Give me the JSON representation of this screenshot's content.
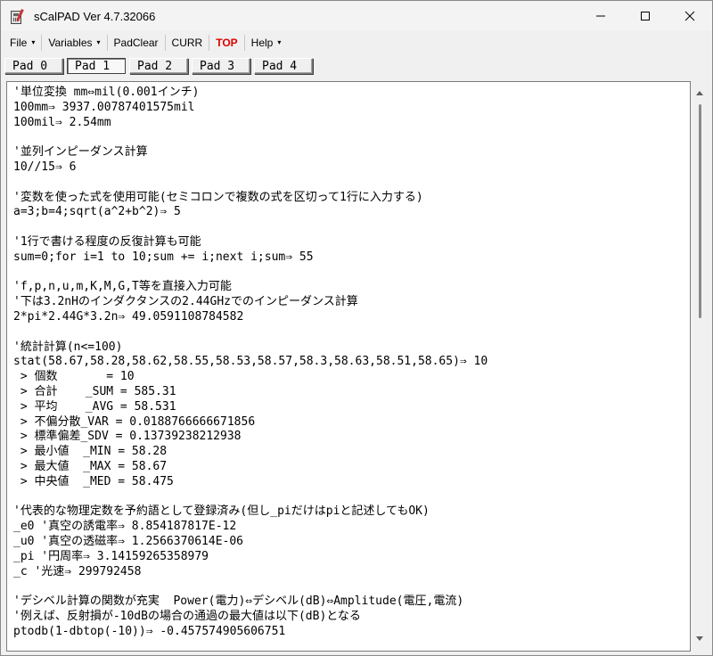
{
  "window": {
    "title": "sCalPAD Ver 4.7.32066"
  },
  "menu": {
    "items": [
      {
        "label": "File",
        "arrow": "▾"
      },
      {
        "label": "Variables",
        "arrow": "▾"
      },
      {
        "label": "PadClear"
      },
      {
        "label": "CURR"
      },
      {
        "label": "TOP"
      },
      {
        "label": "Help",
        "arrow": "▾"
      }
    ]
  },
  "tabs": [
    {
      "label": "Pad 0"
    },
    {
      "label": "Pad 1",
      "active": true
    },
    {
      "label": "Pad 2"
    },
    {
      "label": "Pad 3"
    },
    {
      "label": "Pad 4"
    }
  ],
  "editor": {
    "lines": [
      "'単位変換 mm⇔mil(0.001インチ)",
      "100mm⇒ 3937.00787401575mil",
      "100mil⇒ 2.54mm",
      "",
      "'並列インピーダンス計算",
      "10//15⇒ 6",
      "",
      "'変数を使った式を使用可能(セミコロンで複数の式を区切って1行に入力する)",
      "a=3;b=4;sqrt(a^2+b^2)⇒ 5",
      "",
      "'1行で書ける程度の反復計算も可能",
      "sum=0;for i=1 to 10;sum += i;next i;sum⇒ 55",
      "",
      "'f,p,n,u,m,K,M,G,T等を直接入力可能",
      "'下は3.2nHのインダクタンスの2.44GHzでのインピーダンス計算",
      "2*pi*2.44G*3.2n⇒ 49.0591108784582",
      "",
      "'統計計算(n<=100)",
      "stat(58.67,58.28,58.62,58.55,58.53,58.57,58.3,58.63,58.51,58.65)⇒ 10",
      " > 個数       = 10",
      " > 合計    _SUM = 585.31",
      " > 平均    _AVG = 58.531",
      " > 不偏分散_VAR = 0.0188766666671856",
      " > 標準偏差_SDV = 0.13739238212938",
      " > 最小値  _MIN = 58.28",
      " > 最大値  _MAX = 58.67",
      " > 中央値  _MED = 58.475",
      "",
      "'代表的な物理定数を予約語として登録済み(但し_piだけはpiと記述してもOK)",
      "_e0 '真空の誘電率⇒ 8.854187817E-12",
      "_u0 '真空の透磁率⇒ 1.2566370614E-06",
      "_pi '円周率⇒ 3.14159265358979",
      "_c '光速⇒ 299792458",
      "",
      "'デシベル計算の関数が充実  Power(電力)⇔デシベル(dB)⇔Amplitude(電圧,電流)",
      "'例えば、反射損が-10dBの場合の通過の最大値は以下(dB)となる",
      "ptodb(1-dbtop(-10))⇒ -0.457574905606751"
    ]
  },
  "colors": {
    "top_label": "#e00000"
  }
}
